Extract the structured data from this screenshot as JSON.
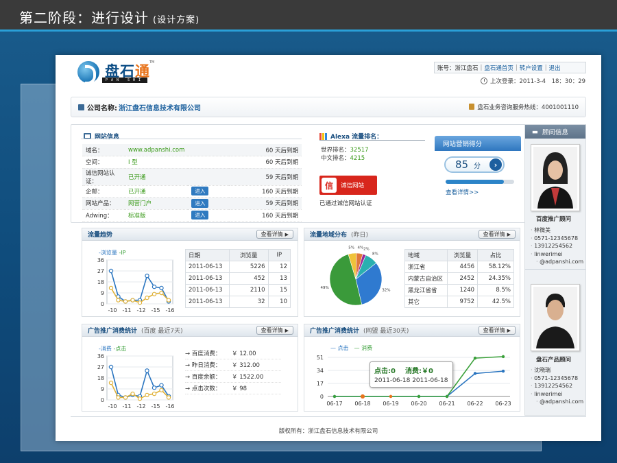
{
  "slide": {
    "title": "第二阶段：进行设计",
    "subtitle": "(设计方案)"
  },
  "header": {
    "logo_text_main": "盘石",
    "logo_text_accent": "通",
    "logo_sub": "PAN SHI TONG",
    "logo_tm": "TM",
    "account": "账号：浙江盘石",
    "nav": [
      "盘石通首页",
      "转户设置",
      "退出"
    ],
    "last_login": "上次登录：2011-3-4　18：30：29"
  },
  "company": {
    "label": "公司名称:",
    "name": "浙江盘石信息技术有限公司",
    "hotline": "盘石业务咨询服务热线：4001001110"
  },
  "site_info": {
    "title": "网站信息",
    "rows": [
      {
        "key": "域名：",
        "value": "www.adpanshi.com",
        "button": "",
        "expire": "60 天后到期"
      },
      {
        "key": "空间：",
        "value": "I 型",
        "button": "",
        "expire": "60 天后到期"
      },
      {
        "key": "诚信网站认证：",
        "value": "已开通",
        "button": "",
        "expire": "59 天后到期"
      },
      {
        "key": "企邮：",
        "value": "已开通",
        "button": "进入",
        "expire": "160 天后到期"
      },
      {
        "key": "网站产品：",
        "value": "网营门户",
        "button": "进入",
        "expire": "59 天后到期"
      },
      {
        "key": "Adwing：",
        "value": "标准版",
        "button": "进入",
        "expire": "160 天后到期"
      }
    ]
  },
  "alexa": {
    "title": "Alexa 流量排名：",
    "world_label": "世界排名：",
    "world": "32517",
    "cn_label": "中文排名：",
    "cn": "4215",
    "badge": "诚信网站",
    "badge_char": "信",
    "verified": "已通过诚信网站认证"
  },
  "score": {
    "title": "网站营销得分",
    "value": "85",
    "unit": "分",
    "progress": 0.85,
    "link": "查看详情>>"
  },
  "traffic_trend": {
    "title": "流量趋势",
    "more": "查看详情",
    "legend_a": "-浏览量",
    "legend_b": "-IP",
    "table": {
      "headers": [
        "日期",
        "浏览量",
        "IP"
      ],
      "rows": [
        [
          "2011-06-13",
          "5226",
          "12"
        ],
        [
          "2011-06-13",
          "452",
          "13"
        ],
        [
          "2011-06-13",
          "2110",
          "15"
        ],
        [
          "2011-06-13",
          "32",
          "10"
        ]
      ]
    }
  },
  "traffic_geo": {
    "title": "流量地域分布",
    "sub": "(昨日)",
    "more": "查看详情",
    "table": {
      "headers": [
        "地域",
        "浏览量",
        "占比"
      ],
      "rows": [
        [
          "浙江省",
          "4456",
          "58.12%"
        ],
        [
          "内蒙古自治区",
          "2452",
          "24.35%"
        ],
        [
          "黑龙江省省",
          "1240",
          "8.5%"
        ],
        [
          "其它",
          "9752",
          "42.5%"
        ]
      ]
    }
  },
  "ad_baidu": {
    "title": "广告推广消费统计",
    "sub": "(百度  最近7天)",
    "more": "查看详情",
    "legend_a": "-消费",
    "legend_b": "-点击",
    "stats": [
      {
        "label": "→ 百度消费：",
        "value": "￥ 12.00"
      },
      {
        "label": "→ 昨日消费：",
        "value": "￥ 312.00"
      },
      {
        "label": "→ 百度余额：",
        "value": "￥ 1522.00"
      },
      {
        "label": "→ 点击次数：",
        "value": "￥ 98"
      }
    ]
  },
  "ad_wangmeng": {
    "title": "广告推广消费统计",
    "sub": "(网盟  最近30天)",
    "more": "查看详情",
    "legend_a": "点击",
    "legend_b": "消费",
    "tooltip": {
      "clicks": "点击:0",
      "cost": "消费:￥0",
      "date_a": "2011-06-18",
      "date_b": "2011-06-18"
    }
  },
  "consultants": {
    "title": "顾问信息",
    "people": [
      {
        "role": "百度推广顾问",
        "lines": [
          "林微美",
          "0571-12345678",
          "13912254562",
          "linwerimei",
          "@adpanshi.com"
        ]
      },
      {
        "role": "盘石产品顾问",
        "lines": [
          "沈晓瑞",
          "0571-12345678",
          "13912254562",
          "linwerimei",
          "@adpanshi.com"
        ]
      }
    ]
  },
  "footer": {
    "copyright": "版权所有：浙江盘石信息技术有限公司"
  },
  "chart_data": [
    {
      "type": "line",
      "title": "流量趋势",
      "categories": [
        "-10",
        "-11",
        "-12",
        "-15",
        "-16"
      ],
      "ylim": [
        0,
        36
      ],
      "yticks": [
        0,
        9,
        18,
        27,
        36
      ],
      "x_positions": [
        -9,
        -10,
        -11,
        -12,
        -13,
        -14,
        -15,
        -15.5,
        -16
      ],
      "series": [
        {
          "name": "-浏览量",
          "color": "#2a75c0",
          "values": [
            27,
            6,
            2,
            3,
            3,
            23,
            14,
            13,
            2
          ]
        },
        {
          "name": "-IP",
          "color": "#e0b23a",
          "values": [
            13,
            3,
            2,
            3,
            1,
            5,
            8,
            9,
            3
          ]
        }
      ],
      "grid": true
    },
    {
      "type": "pie",
      "title": "流量地域分布",
      "labels": [
        "32%",
        "49%",
        "5%",
        "4%",
        "2%",
        "8%"
      ],
      "values": [
        32,
        49,
        5,
        4,
        2,
        8
      ],
      "colors": [
        "#2f7ad0",
        "#3a9a3a",
        "#f0c23a",
        "#e0783a",
        "#9a2a9a",
        "#2ab0b0"
      ]
    },
    {
      "type": "line",
      "title": "广告推广消费统计(百度)",
      "categories": [
        "-10",
        "-11",
        "-12",
        "-15",
        "-16"
      ],
      "ylim": [
        0,
        36
      ],
      "yticks": [
        0,
        9,
        18,
        27,
        36
      ],
      "series": [
        {
          "name": "-消费",
          "color": "#2a75c0",
          "values": [
            27,
            4,
            2,
            4,
            3,
            24,
            10,
            12,
            3
          ]
        },
        {
          "name": "-点击",
          "color": "#e0b23a",
          "values": [
            14,
            2,
            2,
            5,
            1,
            4,
            5,
            8,
            2
          ]
        }
      ],
      "grid": true
    },
    {
      "type": "line",
      "title": "广告推广消费统计(网盟)",
      "categories": [
        "06-17",
        "06-18",
        "06-19",
        "06-20",
        "06-21",
        "06-22",
        "06-23"
      ],
      "ylim": [
        0,
        51
      ],
      "yticks": [
        0,
        17,
        34,
        51
      ],
      "series": [
        {
          "name": "点击",
          "color": "#2a75c0",
          "values": [
            0,
            0,
            0,
            0,
            0,
            30,
            33
          ]
        },
        {
          "name": "消费",
          "color": "#3aa03a",
          "values": [
            0,
            0,
            0,
            0,
            0,
            50,
            52
          ]
        }
      ],
      "grid": true
    }
  ]
}
